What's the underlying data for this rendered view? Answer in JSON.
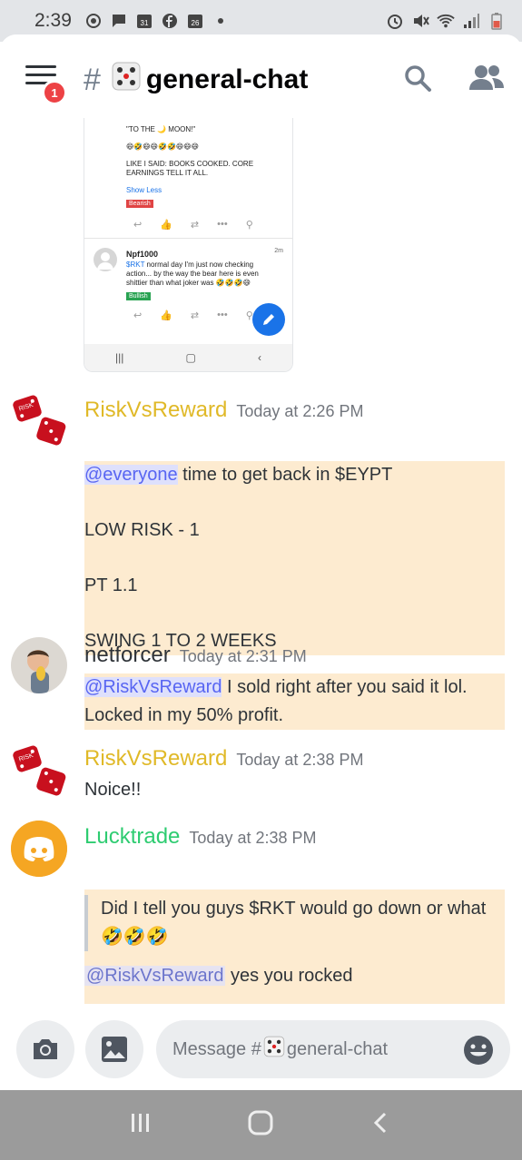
{
  "status_bar": {
    "time": "2:39",
    "calendar_day": "31",
    "calendar_day2": "26"
  },
  "header": {
    "title": "general-chat",
    "hash": "#",
    "badge_count": "1"
  },
  "embed": {
    "line1": "\"TO THE 🌙 MOON!\"",
    "line2": "😄🤣😄😄🤣🤣😄😄😄",
    "line3": "LIKE I SAID: BOOKS COOKED. CORE EARNINGS TELL IT ALL.",
    "show_less": "Show Less",
    "tag1": "Bearish",
    "post2_user": "Npf1000",
    "post2_time": "2m",
    "post2_text_link": "$RKT",
    "post2_text": " normal day I'm just now checking action... by the way the bear here is even shittier than what joker was 🤣🤣🤣😄",
    "tag2": "Bullish"
  },
  "messages": [
    {
      "user": "RiskVsReward",
      "time": "Today at 2:26 PM",
      "mention": "@everyone",
      "line1_rest": " time to get back in $EYPT",
      "line2": "LOW RISK - 1",
      "line3": "PT 1.1",
      "line4": "SWING 1 TO 2 WEEKS"
    },
    {
      "user": "netforcer",
      "time": "Today at 2:31 PM",
      "mention": "@RiskVsReward",
      "rest": " I sold right after you said it lol. Locked in my 50% profit."
    },
    {
      "user": "RiskVsReward",
      "time": "Today at 2:38 PM",
      "text": "Noice!!"
    },
    {
      "user": "Lucktrade",
      "time": "Today at 2:38 PM",
      "quote": "Did I tell you guys $RKT would go down or what 🤣🤣🤣",
      "mention": "@RiskVsReward",
      "rest": " yes you rocked"
    }
  ],
  "input": {
    "placeholder_prefix": "Message #",
    "placeholder_channel": "general-chat"
  },
  "colors": {
    "risk_name": "#e0b928",
    "netforcer_name": "#2e3338",
    "lucktrade_name": "#2ecc71",
    "highlight": "#fdebd0",
    "mention": "#5865f2"
  }
}
